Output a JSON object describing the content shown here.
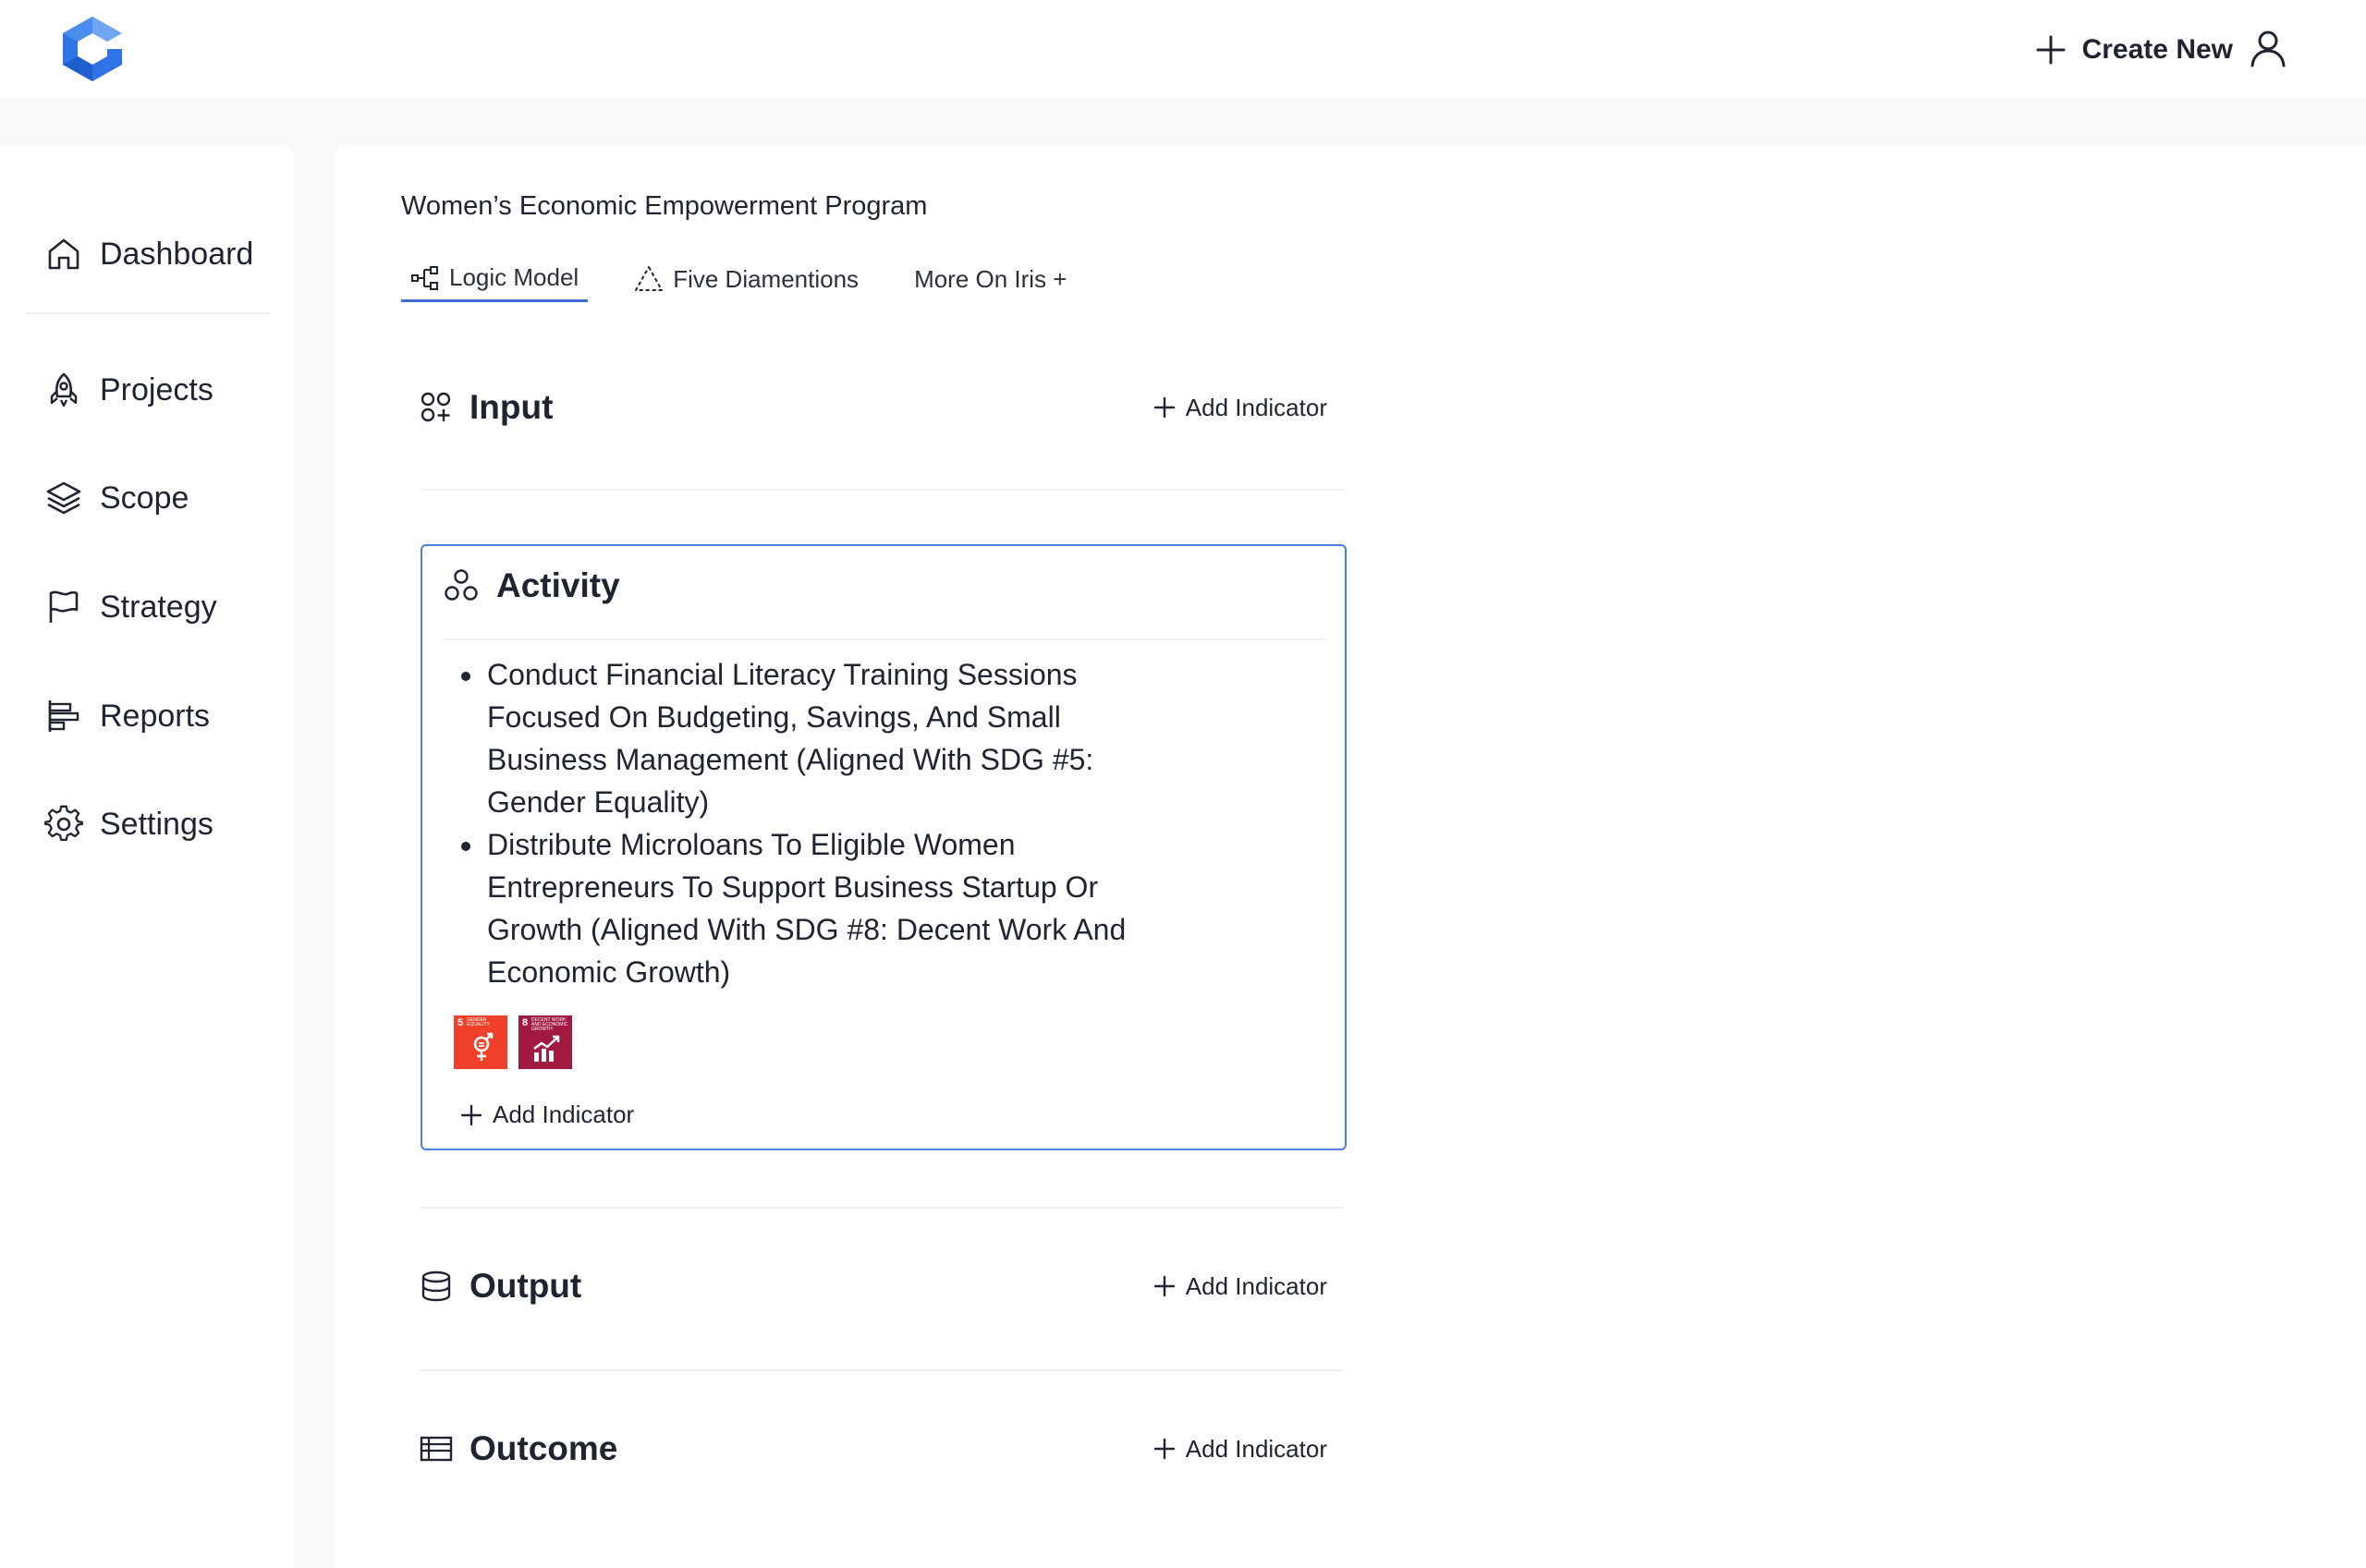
{
  "app": {
    "logo": "logo-icon"
  },
  "header": {
    "create_new_label": "Create New",
    "user_icon": "user-icon"
  },
  "sidebar": {
    "items": [
      {
        "label": "Dashboard",
        "icon": "home-icon"
      },
      {
        "label": "Projects",
        "icon": "rocket-icon"
      },
      {
        "label": "Scope",
        "icon": "layers-icon"
      },
      {
        "label": "Strategy",
        "icon": "flag-icon"
      },
      {
        "label": "Reports",
        "icon": "reports-icon"
      },
      {
        "label": "Settings",
        "icon": "gear-icon"
      }
    ]
  },
  "main": {
    "program_title": "Women’s Economic Empowerment Program",
    "tabs": [
      {
        "label": "Logic Model",
        "icon": "hierarchy-icon",
        "active": true
      },
      {
        "label": "Five Diamentions",
        "icon": "triangle-icon",
        "active": false
      },
      {
        "label": "More On Iris +",
        "active": false
      }
    ],
    "sections": {
      "input": {
        "title": "Input",
        "add_label": "Add Indicator"
      },
      "activity": {
        "title": "Activity",
        "items": [
          "Conduct Financial Literacy Training Sessions Focused On Budgeting, Savings, And Small Business Management (Aligned With SDG #5: Gender Equality)",
          "Distribute Microloans To Eligible Women Entrepreneurs To Support Business Startup Or Growth (Aligned With SDG #8: Decent Work And Economic Growth)"
        ],
        "sdgs": [
          {
            "number": "5",
            "caption": "GENDER EQUALITY",
            "color": "#ef402b"
          },
          {
            "number": "8",
            "caption": "DECENT WORK AND ECONOMIC GROWTH",
            "color": "#a21942"
          }
        ],
        "add_label": "Add Indicator"
      },
      "output": {
        "title": "Output",
        "add_label": "Add Indicator"
      },
      "outcome": {
        "title": "Outcome",
        "add_label": "Add Indicator"
      }
    }
  },
  "colors": {
    "accent": "#3b6fd6",
    "card_border": "#4d7ee0",
    "logo": "#2f74e6"
  }
}
